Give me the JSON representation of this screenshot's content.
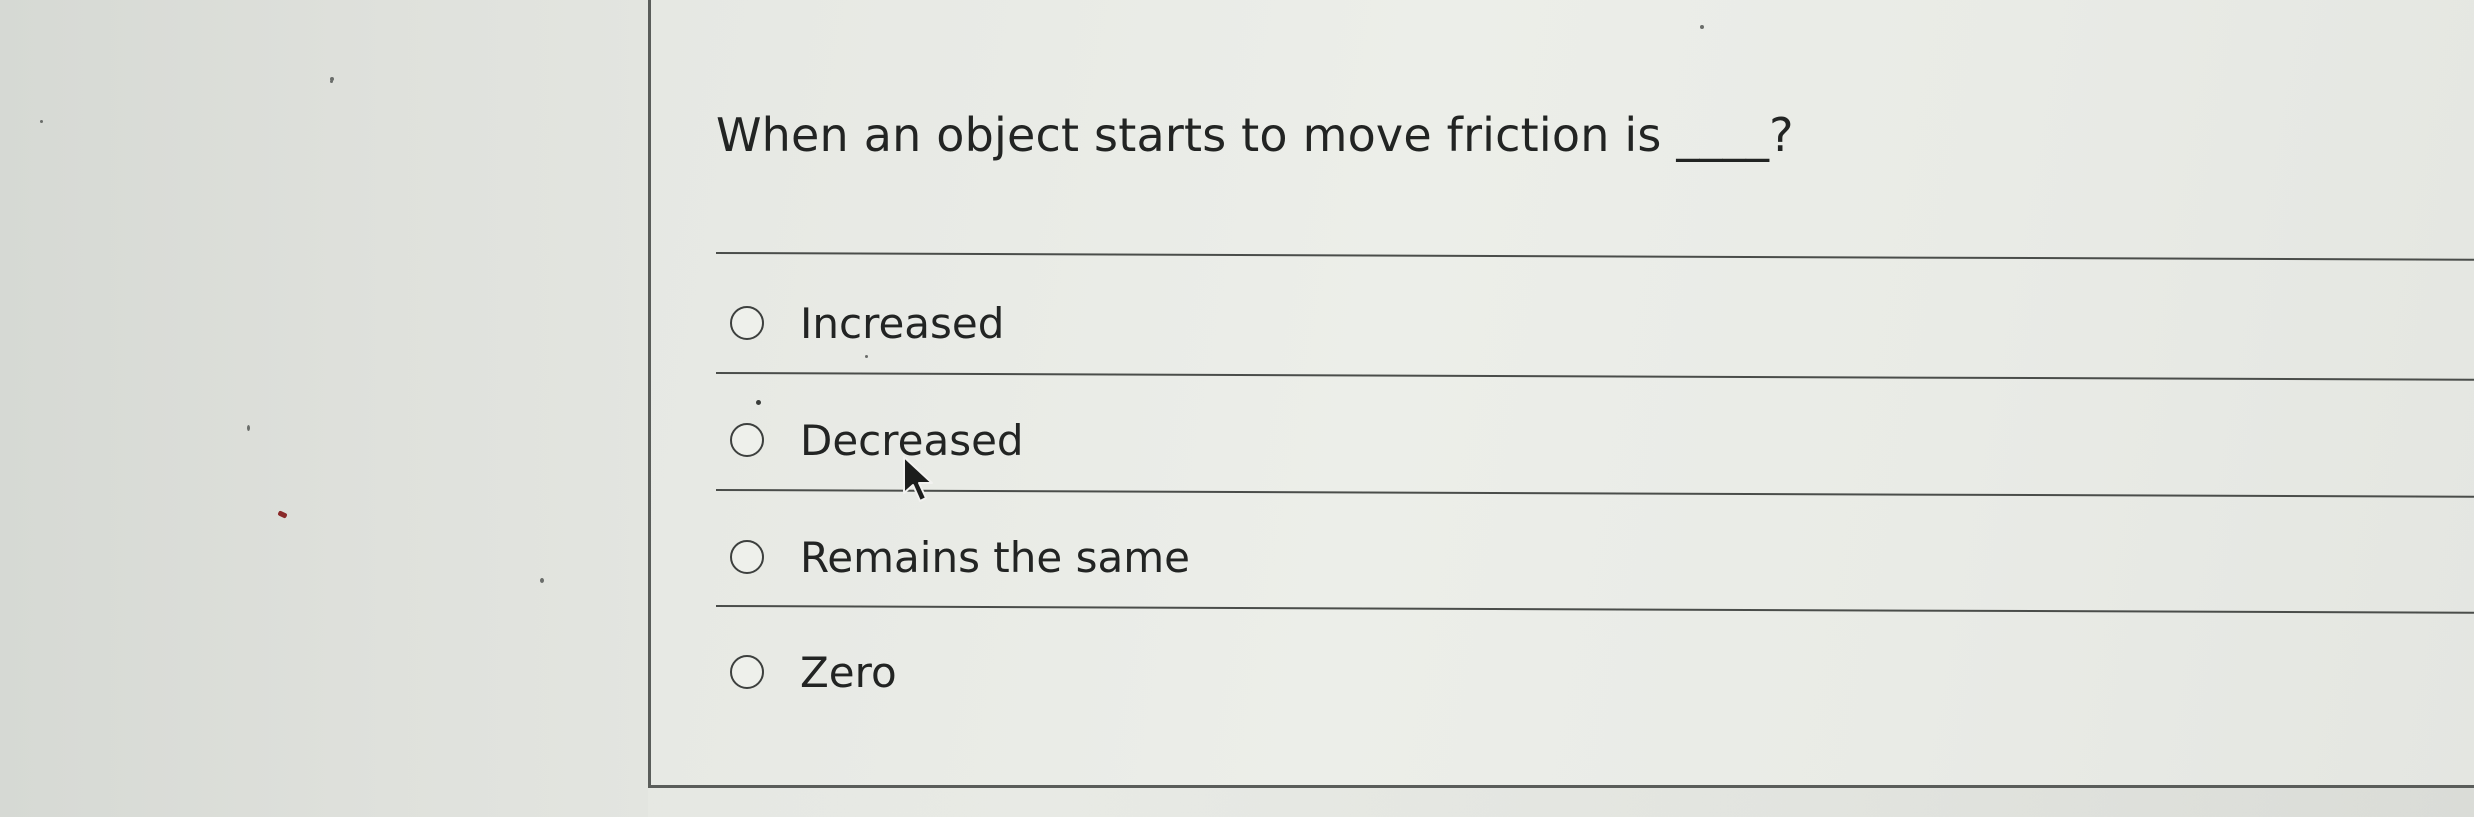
{
  "question": {
    "text": "When an object starts to move friction is ____?"
  },
  "options": [
    {
      "label": "Increased",
      "selected": false
    },
    {
      "label": "Decreased",
      "selected": false
    },
    {
      "label": "Remains the same",
      "selected": false
    },
    {
      "label": "Zero",
      "selected": false
    }
  ],
  "icons": {
    "radio": "radio-button-icon",
    "cursor": "mouse-pointer-icon"
  },
  "colors": {
    "text": "#222423",
    "divider": "#4a4d4a",
    "background": "#e8eae5"
  }
}
